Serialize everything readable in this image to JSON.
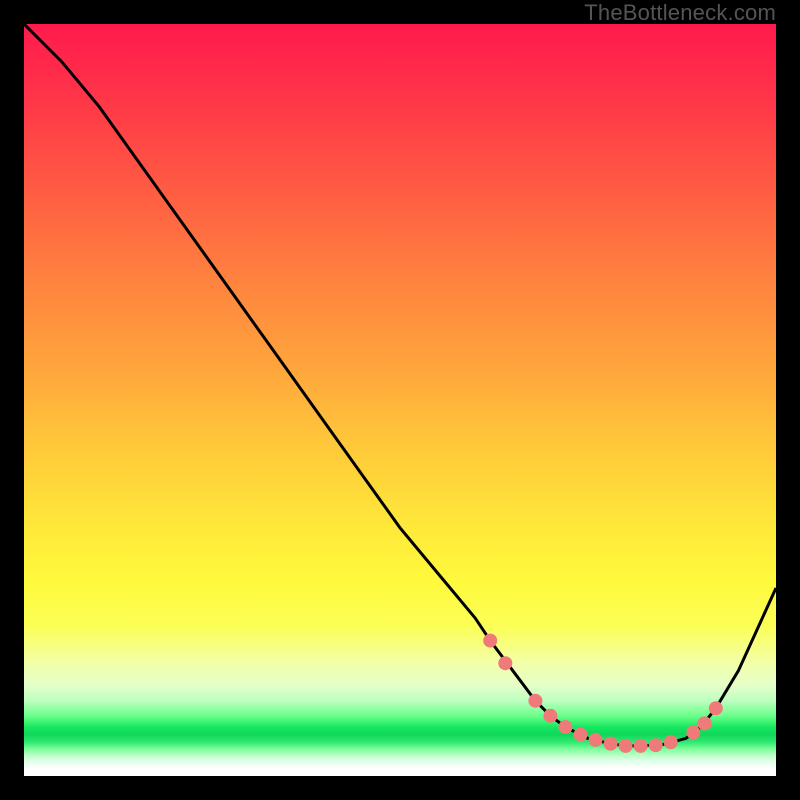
{
  "watermark": "TheBottleneck.com",
  "chart_data": {
    "type": "line",
    "title": "",
    "xlabel": "",
    "ylabel": "",
    "xlim": [
      0,
      100
    ],
    "ylim": [
      0,
      100
    ],
    "grid": false,
    "legend": false,
    "background_gradient": {
      "top": "#ff1a4d",
      "mid_orange": "#ffa63c",
      "mid_yellow": "#fff93c",
      "green_band": "#16e85f"
    },
    "series": [
      {
        "name": "bottleneck-curve",
        "x": [
          0,
          5,
          10,
          15,
          20,
          25,
          30,
          35,
          40,
          45,
          50,
          55,
          60,
          62,
          65,
          68,
          70,
          72,
          75,
          78,
          80,
          82,
          85,
          88,
          90,
          92,
          95,
          100
        ],
        "y": [
          100,
          95,
          89,
          82,
          75,
          68,
          61,
          54,
          47,
          40,
          33,
          27,
          21,
          18,
          14,
          10,
          8,
          6.5,
          5,
          4.3,
          4,
          4,
          4.2,
          5,
          6.5,
          9,
          14,
          25
        ]
      }
    ],
    "markers": {
      "name": "highlight-dots",
      "color": "#f07a7a",
      "points": [
        {
          "x": 62,
          "y": 18
        },
        {
          "x": 64,
          "y": 15
        },
        {
          "x": 68,
          "y": 10
        },
        {
          "x": 70,
          "y": 8
        },
        {
          "x": 72,
          "y": 6.5
        },
        {
          "x": 74,
          "y": 5.5
        },
        {
          "x": 76,
          "y": 4.8
        },
        {
          "x": 78,
          "y": 4.3
        },
        {
          "x": 80,
          "y": 4
        },
        {
          "x": 82,
          "y": 4
        },
        {
          "x": 84,
          "y": 4.1
        },
        {
          "x": 86,
          "y": 4.5
        },
        {
          "x": 89,
          "y": 5.8
        },
        {
          "x": 90.5,
          "y": 7
        },
        {
          "x": 92,
          "y": 9
        }
      ]
    }
  }
}
